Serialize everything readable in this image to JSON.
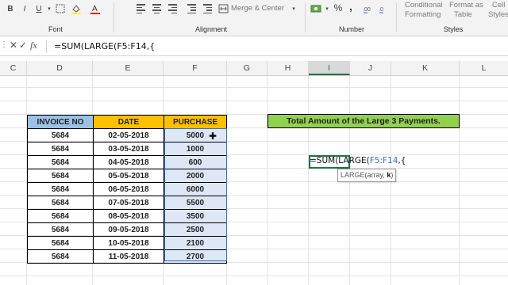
{
  "ribbon": {
    "font_group_label": "Font",
    "alignment_group_label": "Alignment",
    "number_group_label": "Number",
    "styles_group_label": "Styles",
    "merge_center_label": "Merge & Center",
    "conditional_formatting_line1": "Conditional",
    "conditional_formatting_line2": "Formatting",
    "format_as_table_line1": "Format as",
    "format_as_table_line2": "Table",
    "cell_styles_line1": "Cell",
    "cell_styles_line2": "Styles",
    "percent_symbol": "%",
    "comma_symbol": ","
  },
  "formula_bar": {
    "cancel_symbol": "✕",
    "enter_symbol": "✓",
    "fx_symbol": "fx",
    "formula_text": "=SUM(LARGE(F5:F14,{"
  },
  "columns": [
    "C",
    "D",
    "E",
    "F",
    "G",
    "H",
    "I",
    "J",
    "K",
    "L"
  ],
  "active_column": "I",
  "table": {
    "headers": [
      "INVOICE NO",
      "DATE",
      "PURCHASE"
    ],
    "rows": [
      {
        "invoice": "5684",
        "date": "02-05-2018",
        "purchase": "5000"
      },
      {
        "invoice": "5684",
        "date": "03-05-2018",
        "purchase": "1000"
      },
      {
        "invoice": "5684",
        "date": "04-05-2018",
        "purchase": "600"
      },
      {
        "invoice": "5684",
        "date": "05-05-2018",
        "purchase": "2000"
      },
      {
        "invoice": "5684",
        "date": "06-05-2018",
        "purchase": "6000"
      },
      {
        "invoice": "5684",
        "date": "07-05-2018",
        "purchase": "5500"
      },
      {
        "invoice": "5684",
        "date": "08-05-2018",
        "purchase": "3500"
      },
      {
        "invoice": "5684",
        "date": "09-05-2018",
        "purchase": "2500"
      },
      {
        "invoice": "5684",
        "date": "10-05-2018",
        "purchase": "2100"
      },
      {
        "invoice": "5684",
        "date": "11-05-2018",
        "purchase": "2700"
      }
    ]
  },
  "title_text": "Total Amount of the Large 3 Payments.",
  "editing_cell": {
    "prefix": "=SUM(LARGE(",
    "range_ref": "F5:F14",
    "suffix": ",{"
  },
  "tooltip": {
    "prefix": "LARGE(array, ",
    "bold_arg": "k",
    "suffix": ")"
  },
  "colors": {
    "excel_green": "#217346",
    "invoice_header": "#9bc2e6",
    "date_purchase_header": "#ffc000",
    "title_fill": "#92d050",
    "range_blue": "#2f6fd0"
  }
}
